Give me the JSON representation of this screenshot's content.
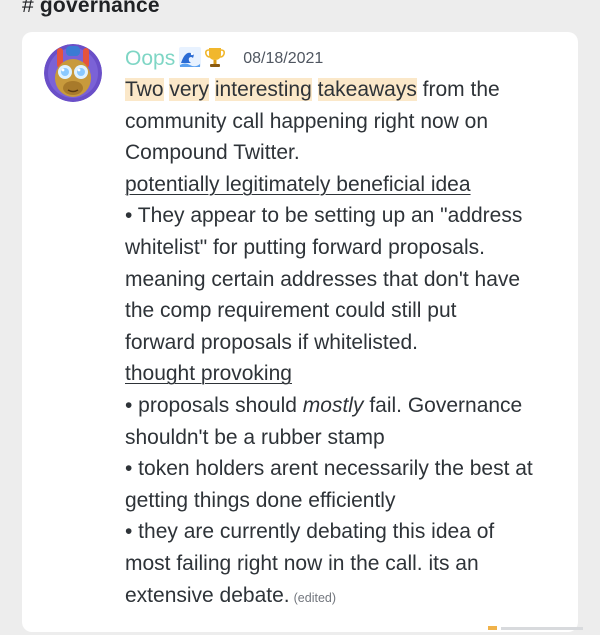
{
  "channel": {
    "hash": "#",
    "name": "governance"
  },
  "message": {
    "author": "Oops",
    "badges": [
      "wave-emoji-icon",
      "trophy-emoji-icon"
    ],
    "timestamp": "08/18/2021",
    "lines": {
      "h1": "Two",
      "h2": "very",
      "h3": "interesting",
      "h4": "takeaways",
      "l1_rest": " from the",
      "l2": "community call happening right now on",
      "l3": "Compound Twitter.",
      "l4": "potentially legitimately beneficial idea",
      "l5": "• They appear to be setting up an \"address",
      "l6": "whitelist\" for putting forward proposals.",
      "l7": "meaning certain addresses that don't have",
      "l8": "the comp requirement could still put",
      "l9": "forward proposals if whitelisted.",
      "l10": "thought provoking",
      "l11a": "• proposals should ",
      "l11b": "mostly",
      "l11c": " fail. Governance",
      "l12": "shouldn't be a rubber stamp",
      "l13": "• token holders arent necessarily the best at",
      "l14": "getting things done efficiently",
      "l15": "• they are currently debating this idea of",
      "l16": "most failing right now in the call. its an",
      "l17": "extensive debate."
    },
    "edited_label": "(edited)"
  },
  "colors": {
    "background": "#ededed",
    "card": "#ffffff",
    "author": "#7fd6c5",
    "highlight": "#fbe8c9",
    "text": "#2e3338",
    "muted": "#72767d"
  }
}
